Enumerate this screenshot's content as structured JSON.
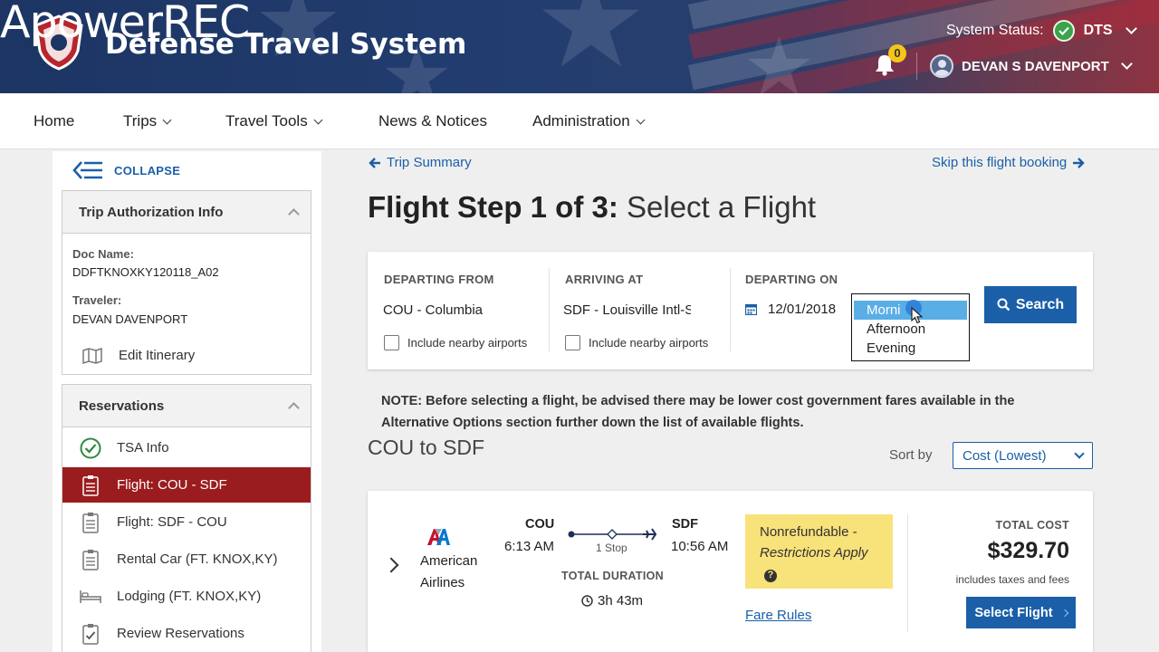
{
  "header": {
    "watermark": "ApowerREC",
    "app_title": "Defense Travel System",
    "system_status_label": "System Status:",
    "system_status_value": "DTS",
    "notification_count": "0",
    "user_name": "DEVAN S DAVENPORT",
    "colors": {
      "navy": "#1c3563",
      "status_green": "#3ba349",
      "badge_yellow": "#f5c518"
    }
  },
  "nav": {
    "items": [
      {
        "label": "Home",
        "dropdown": false
      },
      {
        "label": "Trips",
        "dropdown": true
      },
      {
        "label": "Travel Tools",
        "dropdown": true
      },
      {
        "label": "News & Notices",
        "dropdown": false
      },
      {
        "label": "Administration",
        "dropdown": true
      }
    ]
  },
  "sidebar": {
    "collapse_label": "COLLAPSE",
    "trip_info": {
      "title": "Trip Authorization Info",
      "doc_name_label": "Doc Name:",
      "doc_name": "DDFTKNOXKY120118_A02",
      "traveler_label": "Traveler:",
      "traveler": "DEVAN DAVENPORT",
      "edit_itinerary": "Edit Itinerary"
    },
    "reservations": {
      "title": "Reservations",
      "items": [
        {
          "label": "TSA Info",
          "icon": "check-circle-icon",
          "active": false
        },
        {
          "label": "Flight: COU - SDF",
          "icon": "checklist-icon",
          "active": true
        },
        {
          "label": "Flight: SDF - COU",
          "icon": "checklist-icon",
          "active": false
        },
        {
          "label": "Rental Car (FT. KNOX,KY)",
          "icon": "checklist-icon",
          "active": false
        },
        {
          "label": "Lodging (FT. KNOX,KY)",
          "icon": "bed-icon",
          "active": false
        },
        {
          "label": "Review Reservations",
          "icon": "review-check-icon",
          "active": false
        }
      ],
      "active_color": "#9b1c1f"
    }
  },
  "main": {
    "back_link": "Trip Summary",
    "skip_link": "Skip this flight booking",
    "title_bold": "Flight Step 1 of 3:",
    "title_light": "Select a Flight",
    "search": {
      "departing_from_label": "DEPARTING FROM",
      "departing_from_value": "COU - Columbia",
      "arriving_at_label": "ARRIVING AT",
      "arriving_at_value": "SDF - Louisville Intl-S",
      "nearby_label": "Include nearby airports",
      "departing_on_label": "DEPARTING ON",
      "date": "12/01/2018",
      "time_options": [
        "Morni",
        "Afternoon",
        "Evening"
      ],
      "selected_time_index": 0,
      "search_button": "Search"
    },
    "note": "NOTE: Before selecting a flight, be advised there may be lower cost government fares available in the Alternative Options section further down the list of available flights.",
    "route_title": "COU to SDF",
    "sort_label": "Sort by",
    "sort_value": "Cost (Lowest)",
    "flight": {
      "airline_line1": "American",
      "airline_line2": "Airlines",
      "dep_code": "COU",
      "dep_time": "6:13 AM",
      "arr_code": "SDF",
      "arr_time": "10:56 AM",
      "stops": "1 Stop",
      "duration_label": "TOTAL DURATION",
      "duration": "3h 43m",
      "fare_line1": "Nonrefundable -",
      "fare_line2": "Restrictions Apply",
      "fare_rules": "Fare Rules",
      "total_cost_label": "TOTAL COST",
      "total_cost": "$329.70",
      "cost_note": "includes taxes and fees",
      "select_button": "Select Flight"
    }
  }
}
